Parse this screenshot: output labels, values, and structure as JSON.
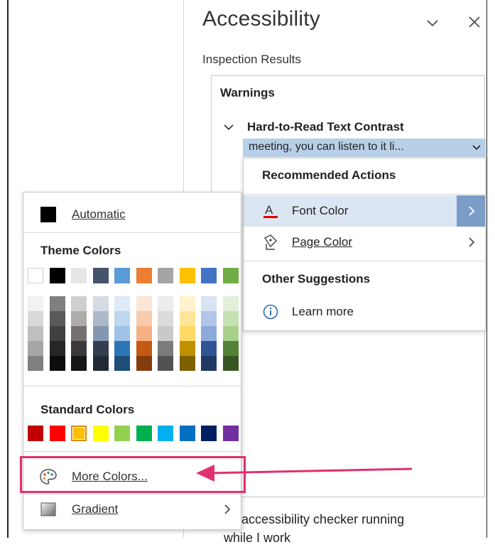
{
  "pane": {
    "title": "Accessibility",
    "subtitle": "Inspection Results",
    "warnings_label": "Warnings",
    "issue_title": "Hard-to-Read Text Contrast",
    "issue_item": "meeting, you can listen to it li...",
    "keep_checker_label_line1": "ep accessibility checker running",
    "keep_checker_label_line2": "while I work"
  },
  "actions_menu": {
    "recommended_header": "Recommended Actions",
    "font_color_label": "Font Color",
    "page_color_label": "Page Color",
    "other_header": "Other Suggestions",
    "learn_more_label": "Learn more"
  },
  "color_menu": {
    "automatic_label": "Automatic",
    "theme_header": "Theme Colors",
    "standard_header": "Standard Colors",
    "more_colors_label": "More Colors...",
    "gradient_label": "Gradient",
    "theme_colors": [
      "#ffffff",
      "#000000",
      "#e7e6e6",
      "#44546a",
      "#5b9bd5",
      "#ed7d31",
      "#a5a5a5",
      "#ffc000",
      "#4472c4",
      "#70ad47"
    ],
    "theme_tints": [
      [
        "#f2f2f2",
        "#d9d9d9",
        "#bfbfbf",
        "#a6a6a6",
        "#808080"
      ],
      [
        "#7f7f7f",
        "#595959",
        "#404040",
        "#262626",
        "#0d0d0d"
      ],
      [
        "#d0cece",
        "#aeabab",
        "#757171",
        "#3a3838",
        "#171616"
      ],
      [
        "#d6dce4",
        "#adb9ca",
        "#8497b0",
        "#333f4f",
        "#222a35"
      ],
      [
        "#deebf6",
        "#bdd7ee",
        "#9dc3e6",
        "#2e75b5",
        "#1f4e79"
      ],
      [
        "#fbe5d5",
        "#f7cbac",
        "#f4b183",
        "#c45911",
        "#833c0b"
      ],
      [
        "#ededed",
        "#dbdbdb",
        "#c9c9c9",
        "#7b7b7b",
        "#525252"
      ],
      [
        "#fff2cc",
        "#fee599",
        "#ffd965",
        "#bf9000",
        "#7f6000"
      ],
      [
        "#dae3f3",
        "#b4c6e7",
        "#8eaadb",
        "#2f5496",
        "#1f3864"
      ],
      [
        "#e2efd9",
        "#c5e0b3",
        "#a8d08d",
        "#538135",
        "#375623"
      ]
    ],
    "standard_colors": [
      "#c00000",
      "#ff0000",
      "#ffc000",
      "#ffff00",
      "#92d050",
      "#00b050",
      "#00b0f0",
      "#0070c0",
      "#002060",
      "#7030a0"
    ],
    "selected_standard_index": 2
  },
  "accent": {
    "callout": "#e0306f",
    "font_color_underline": "#e00000",
    "menu_highlight": "#dce6f3",
    "item_selected": "#b8cfe8"
  }
}
